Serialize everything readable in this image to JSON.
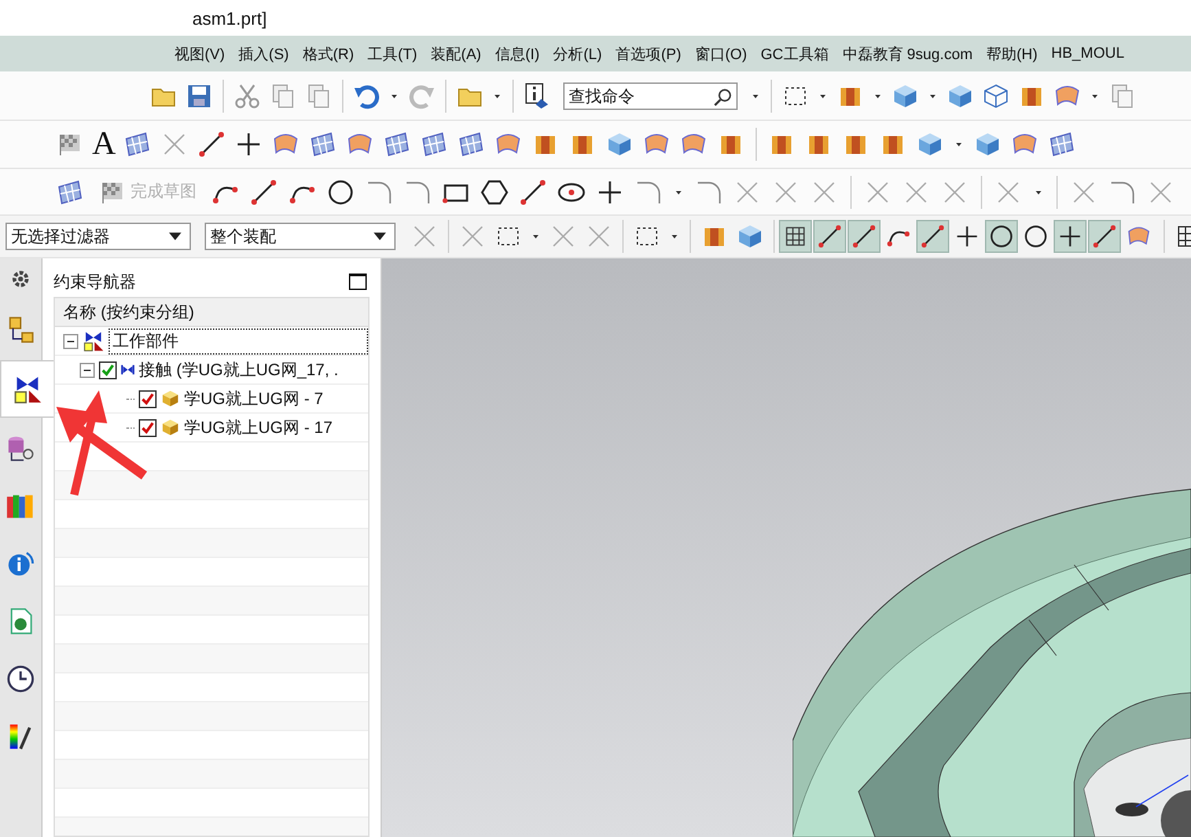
{
  "window": {
    "title": "asm1.prt]"
  },
  "menu": [
    "视图(V)",
    "插入(S)",
    "格式(R)",
    "工具(T)",
    "装配(A)",
    "信息(I)",
    "分析(L)",
    "首选项(P)",
    "窗口(O)",
    "GC工具箱",
    "中磊教育 9sug.com",
    "帮助(H)",
    "HB_MOUL"
  ],
  "search": {
    "placeholder": "查找命令"
  },
  "text_tool_glyph": "A",
  "finish_sketch": {
    "label": "完成草图",
    "disabled": true
  },
  "filters": [
    {
      "value": "无选择过滤器"
    },
    {
      "value": "整个装配"
    }
  ],
  "snap_buttons": [
    {
      "selected": true
    },
    {
      "selected": true
    },
    {
      "selected": true
    },
    {
      "selected": false
    },
    {
      "selected": true
    },
    {
      "selected": false
    },
    {
      "selected": true
    },
    {
      "selected": false
    },
    {
      "selected": true
    },
    {
      "selected": true
    },
    {
      "selected": false
    }
  ],
  "resource_tabs": [
    {
      "selected": false
    },
    {
      "selected": true
    },
    {
      "selected": false
    },
    {
      "selected": false
    },
    {
      "selected": false
    },
    {
      "selected": false
    },
    {
      "selected": false
    },
    {
      "selected": false
    }
  ],
  "navigator": {
    "title": "约束导航器",
    "column": "名称 (按约束分组)",
    "tree": [
      {
        "label": "工作部件",
        "expanded": true,
        "children": [
          {
            "label": "接触 (学UG就上UG网_17, .",
            "checked": true,
            "expanded": true,
            "children": [
              {
                "label": "学UG就上UG网 - 7",
                "checked": true
              },
              {
                "label": "学UG就上UG网 - 17",
                "checked": true
              }
            ]
          }
        ]
      }
    ]
  }
}
